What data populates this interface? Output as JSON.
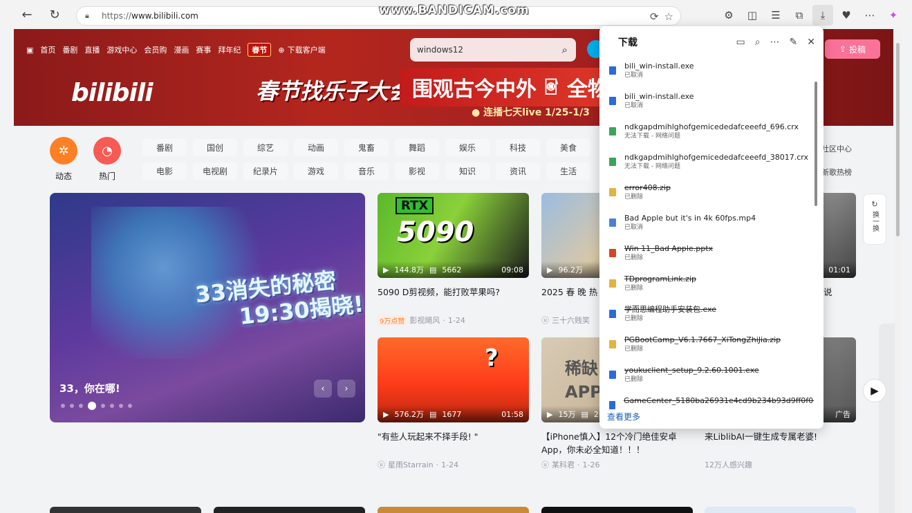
{
  "browser": {
    "url_prefix": "https://",
    "url_host": "www.bilibili.com",
    "watermark": "www.BANDICAM.com"
  },
  "bili": {
    "topnav": [
      "首页",
      "番剧",
      "直播",
      "游戏中心",
      "会员购",
      "漫画",
      "赛事",
      "拜年纪"
    ],
    "festival_badge": "春节",
    "download_client": "下载客户端",
    "search_value": "windows12",
    "upload_label": "投稿",
    "logo": "bilibili",
    "banner_text1": "春节找乐子大会",
    "banner_text2": "围观古今中外",
    "banner_text2b": "全物种",
    "banner_sub": "● 连播七天live 1/25-1/3"
  },
  "channels": {
    "dynamic_label": "动态",
    "hot_label": "热门",
    "row1": [
      "番剧",
      "国创",
      "综艺",
      "动画",
      "鬼畜",
      "舞蹈",
      "娱乐",
      "科技",
      "美食"
    ],
    "row2": [
      "电影",
      "电视剧",
      "纪录片",
      "游戏",
      "音乐",
      "影视",
      "知识",
      "资讯",
      "生活"
    ],
    "right1": "社区中心",
    "right2": "新歌热榜"
  },
  "carousel": {
    "title_art_line1": "33消失的秘密",
    "title_art_line2": "19:30揭晓!",
    "caption": "33，你在哪!",
    "prev": "‹",
    "next": "›"
  },
  "videos": [
    {
      "plays": "144.8万",
      "danmaku": "5662",
      "duration": "09:08",
      "title": "5090 D剪视频，能打败苹果吗?",
      "badge": "9万点赞",
      "author": "影视飓风",
      "date": "1-24",
      "thumb_text": "5090",
      "thumb_tag": "RTX"
    },
    {
      "plays": "96.2万",
      "danmaku": "",
      "duration": "",
      "title": "2025 春 晚 热",
      "badge": "",
      "author": "三十六贱笑",
      "date": ""
    },
    {
      "plays": "",
      "danmaku": "",
      "duration": "01:01",
      "title": "说",
      "badge": "",
      "author": "",
      "date": ""
    },
    {
      "plays": "576.2万",
      "danmaku": "1677",
      "duration": "01:58",
      "title": "\"有些人玩起来不择手段! \"",
      "badge": "",
      "author": "星雨Starrain",
      "date": "1-24",
      "thumb_text": "?"
    },
    {
      "plays": "15万",
      "danmaku": "2",
      "duration": "",
      "title": "【iPhone慎入】12个冷门绝佳安卓App，你未必全知道！！！",
      "badge": "",
      "author": "某科君",
      "date": "1-26",
      "thumb_text1": "稀缺",
      "thumb_text2": "APP"
    },
    {
      "plays": "",
      "danmaku": "",
      "duration": "广告",
      "title": "来LiblibAI一键生成专属老婆!",
      "badge": "",
      "author": "12万人感兴趣",
      "date": ""
    }
  ],
  "refresh": {
    "icon": "↻",
    "label": "换一换"
  },
  "downloads": {
    "title": "下载",
    "see_more": "查看更多",
    "items": [
      {
        "name": "bili_win-install.exe",
        "status": "已取消",
        "type": "exe",
        "struck": false
      },
      {
        "name": "bili_win-install.exe",
        "status": "已取消",
        "type": "exe",
        "struck": false
      },
      {
        "name": "ndkgapdmihlghofgemicededafceeefd_696.crx",
        "status": "无法下载 - 网络问题",
        "type": "crx",
        "struck": false
      },
      {
        "name": "ndkgapdmihlghofgemicededafceeefd_38017.crx",
        "status": "无法下载 - 网络问题",
        "type": "crx",
        "struck": false
      },
      {
        "name": "error408.zip",
        "status": "已删除",
        "type": "zip",
        "struck": true
      },
      {
        "name": "Bad Apple but it's in 4k 60fps.mp4",
        "status": "已取消",
        "type": "mp4",
        "struck": false
      },
      {
        "name": "Win 11_Bad Apple.pptx",
        "status": "已删除",
        "type": "pptx",
        "struck": true
      },
      {
        "name": "TDprogramLink.zip",
        "status": "已删除",
        "type": "zip",
        "struck": true
      },
      {
        "name": "学而思编程助手安装包.exe",
        "status": "已删除",
        "type": "exe",
        "struck": true
      },
      {
        "name": "PGBootCamp_V6.1.7667_XiTongZhiJia.zip",
        "status": "已删除",
        "type": "zip",
        "struck": true
      },
      {
        "name": "youkuclient_setup_9.2.60.1001.exe",
        "status": "已删除",
        "type": "exe",
        "struck": true
      },
      {
        "name": "GameCenter_5180ba26931e4cd9b234b93d9ff0f0b7",
        "status": "",
        "type": "exe",
        "struck": true
      }
    ]
  },
  "colors": {
    "bili_pink": "#fb7299",
    "bili_blue": "#00aeec",
    "header_red": "#b3261e"
  }
}
